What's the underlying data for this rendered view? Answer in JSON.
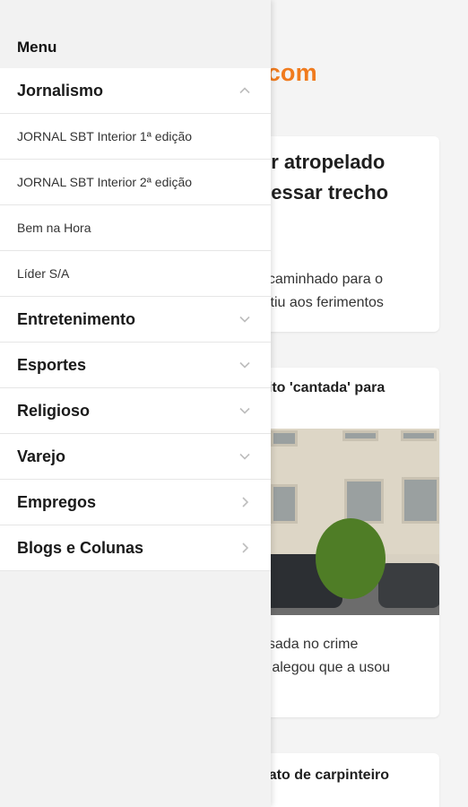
{
  "background": {
    "logo_text": ".com",
    "card1": {
      "headline_line1": "er atropelado",
      "headline_line2": "vessar trecho",
      "summary_line1": "ncaminhado para o",
      "summary_line2": "istiu aos ferimentos"
    },
    "card2": {
      "headline": "eito 'cantada' para",
      "summary_line1": "usada no crime",
      "summary_line2": "o alegou que a usou"
    },
    "card3": {
      "headline": "nato de carpinteiro"
    }
  },
  "drawer": {
    "title": "Menu",
    "items": [
      {
        "label": "Jornalismo",
        "icon": "chevron-up-icon",
        "expanded": true,
        "children": [
          {
            "label": "JORNAL SBT Interior 1ª edição"
          },
          {
            "label": "JORNAL SBT Interior 2ª edição"
          },
          {
            "label": "Bem na Hora"
          },
          {
            "label": "Líder S/A"
          }
        ]
      },
      {
        "label": "Entretenimento",
        "icon": "chevron-down-icon"
      },
      {
        "label": "Esportes",
        "icon": "chevron-down-icon"
      },
      {
        "label": "Religioso",
        "icon": "chevron-down-icon"
      },
      {
        "label": "Varejo",
        "icon": "chevron-down-icon"
      },
      {
        "label": "Empregos",
        "icon": "chevron-right-icon"
      },
      {
        "label": "Blogs e Colunas",
        "icon": "chevron-right-icon"
      }
    ]
  },
  "colors": {
    "accent": "#f07b1e",
    "drawer_bg": "#f2f2f2",
    "chevron": "#bdbdbd"
  }
}
